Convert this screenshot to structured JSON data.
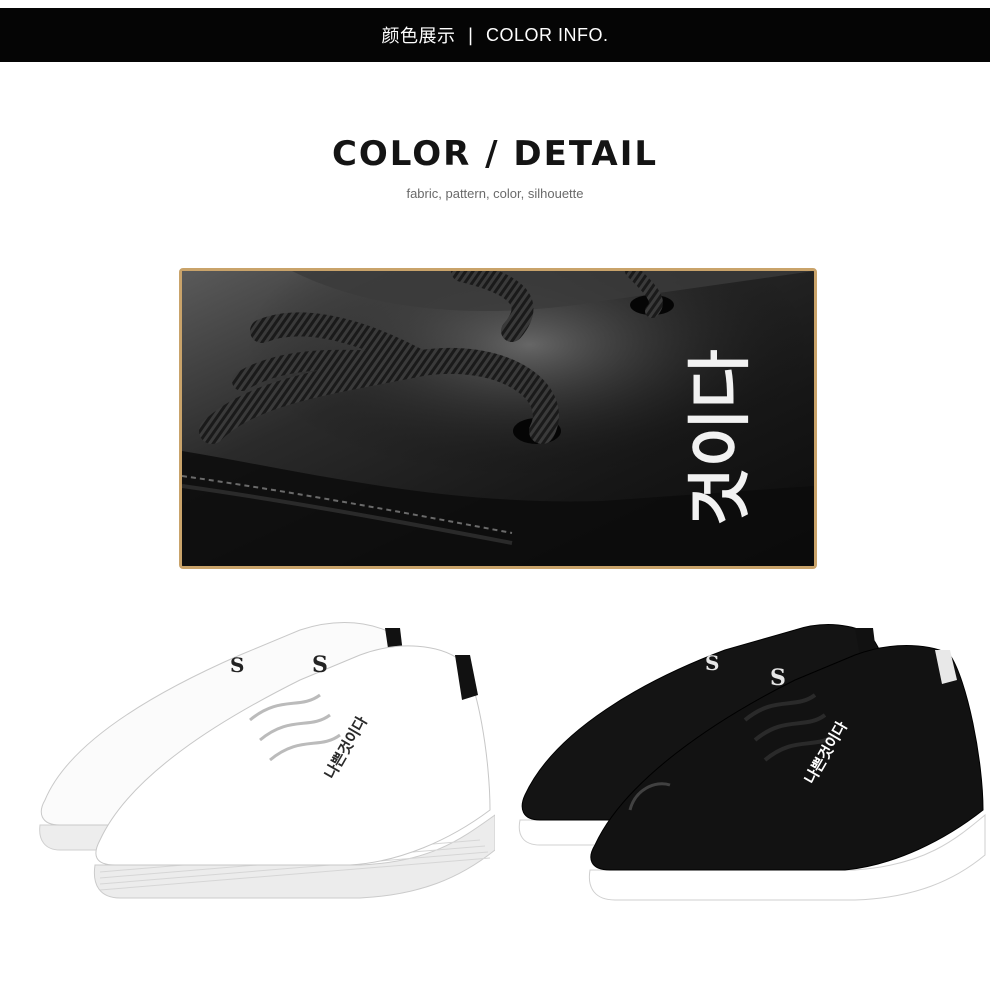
{
  "header": {
    "title_cn": "颜色展示",
    "separator": "|",
    "title_en": "COLOR INFO."
  },
  "section": {
    "title": "COLOR / DETAIL",
    "subtitle": "fabric, pattern, color, silhouette"
  },
  "detail_image": {
    "print_text": "것이다",
    "border_color": "#c9a36a"
  },
  "products": {
    "white_shoe": {
      "color": "#f7f7f7",
      "print_text": "나쁜것이다",
      "tongue_letter": "S"
    },
    "black_shoe": {
      "color": "#111111",
      "print_text": "나쁜것이다",
      "tongue_letter": "S"
    }
  }
}
